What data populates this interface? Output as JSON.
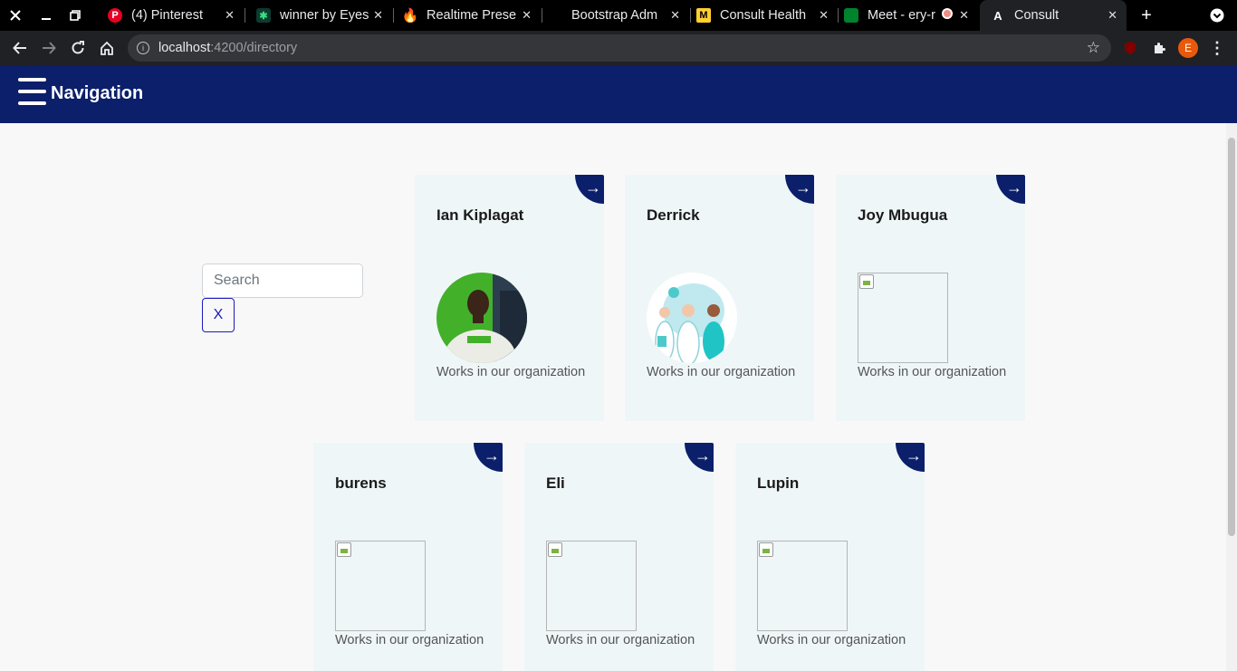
{
  "browser": {
    "tabs": [
      {
        "title": "(4) Pinterest"
      },
      {
        "title": "winner by Eyes"
      },
      {
        "title": "Realtime Prese"
      },
      {
        "title": "Bootstrap Adm"
      },
      {
        "title": "Consult Health"
      },
      {
        "title": "Meet - ery-r"
      },
      {
        "title": "Consult"
      }
    ],
    "url_host": "localhost",
    "url_path": ":4200/directory",
    "profile_initial": "E"
  },
  "app": {
    "nav_title": "Navigation",
    "search_placeholder": "Search",
    "clear_label": "X",
    "accent_color": "#0b1f6b"
  },
  "people": [
    {
      "name": "Ian Kiplagat",
      "description": "Works in our organization",
      "image": "photo"
    },
    {
      "name": "Derrick",
      "description": "Works in our organization",
      "image": "illustration"
    },
    {
      "name": "Joy Mbugua",
      "description": "Works in our organization",
      "image": "broken"
    },
    {
      "name": "burens",
      "description": "Works in our organization",
      "image": "broken"
    },
    {
      "name": "Eli",
      "description": "Works in our organization",
      "image": "broken"
    },
    {
      "name": "Lupin",
      "description": "Works in our organization",
      "image": "broken"
    }
  ],
  "icons": {
    "card_link": "→"
  }
}
